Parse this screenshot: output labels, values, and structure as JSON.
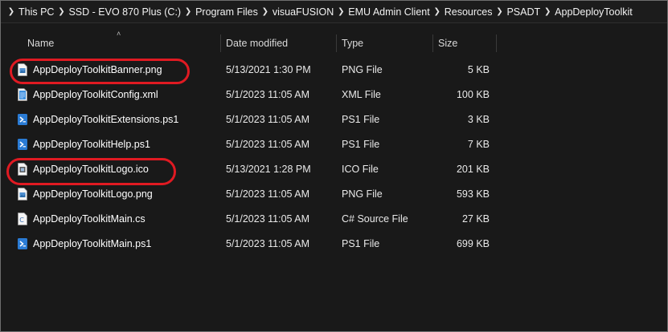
{
  "breadcrumb": [
    "This PC",
    "SSD - EVO 870 Plus (C:)",
    "Program Files",
    "visuaFUSION",
    "EMU Admin Client",
    "Resources",
    "PSADT",
    "AppDeployToolkit"
  ],
  "columns": {
    "name": "Name",
    "date": "Date modified",
    "type": "Type",
    "size": "Size"
  },
  "files": [
    {
      "name": "AppDeployToolkitBanner.png",
      "date": "5/13/2021 1:30 PM",
      "type": "PNG File",
      "size": "5 KB",
      "icon": "png-file-icon",
      "highlighted": true
    },
    {
      "name": "AppDeployToolkitConfig.xml",
      "date": "5/1/2023 11:05 AM",
      "type": "XML File",
      "size": "100 KB",
      "icon": "xml-file-icon",
      "highlighted": false
    },
    {
      "name": "AppDeployToolkitExtensions.ps1",
      "date": "5/1/2023 11:05 AM",
      "type": "PS1 File",
      "size": "3 KB",
      "icon": "powershell-file-icon",
      "highlighted": false
    },
    {
      "name": "AppDeployToolkitHelp.ps1",
      "date": "5/1/2023 11:05 AM",
      "type": "PS1 File",
      "size": "7 KB",
      "icon": "powershell-file-icon",
      "highlighted": false
    },
    {
      "name": "AppDeployToolkitLogo.ico",
      "date": "5/13/2021 1:28 PM",
      "type": "ICO File",
      "size": "201 KB",
      "icon": "ico-file-icon",
      "highlighted": true
    },
    {
      "name": "AppDeployToolkitLogo.png",
      "date": "5/1/2023 11:05 AM",
      "type": "PNG File",
      "size": "593 KB",
      "icon": "png-file-icon",
      "highlighted": false
    },
    {
      "name": "AppDeployToolkitMain.cs",
      "date": "5/1/2023 11:05 AM",
      "type": "C# Source File",
      "size": "27 KB",
      "icon": "csharp-file-icon",
      "highlighted": false
    },
    {
      "name": "AppDeployToolkitMain.ps1",
      "date": "5/1/2023 11:05 AM",
      "type": "PS1 File",
      "size": "699 KB",
      "icon": "powershell-file-icon",
      "highlighted": false
    }
  ],
  "colors": {
    "background": "#191919",
    "annotation": "#e01a22",
    "powershell": "#2a7bd4"
  }
}
